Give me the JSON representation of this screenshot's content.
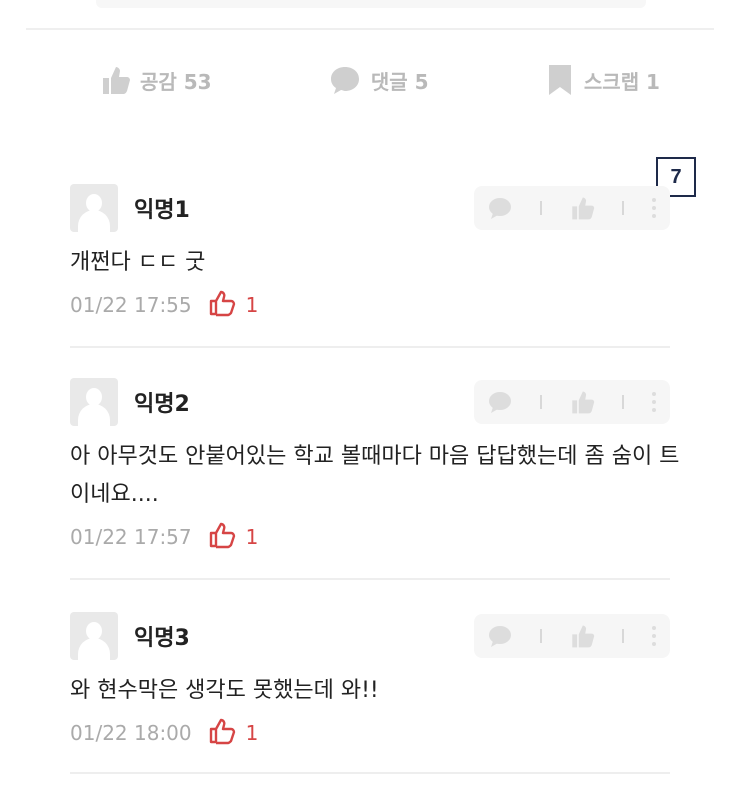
{
  "post_actions": {
    "like": {
      "label": "공감 53",
      "icon": "thumbs-up-icon"
    },
    "comment": {
      "label": "댓글 5",
      "icon": "speech-bubble-icon"
    },
    "scrap": {
      "label": "스크랩 1",
      "icon": "bookmark-icon"
    }
  },
  "annotation_badge": "7",
  "comments": [
    {
      "nickname": "익명1",
      "text": "개쩐다 ㄷㄷ 굿",
      "time": "01/22 17:55",
      "likes": "1"
    },
    {
      "nickname": "익명2",
      "text": "아 아무것도 안붙어있는 학교 볼때마다 마음 답답했는데 좀 숨이 트이네요....",
      "time": "01/22 17:57",
      "likes": "1"
    },
    {
      "nickname": "익명3",
      "text": "와 현수막은 생각도 못했는데 와!!",
      "time": "01/22 18:00",
      "likes": "1"
    }
  ],
  "colors": {
    "muted": "#b9b9b9",
    "like_red": "#d64545",
    "badge_border": "#1e2a4a"
  }
}
